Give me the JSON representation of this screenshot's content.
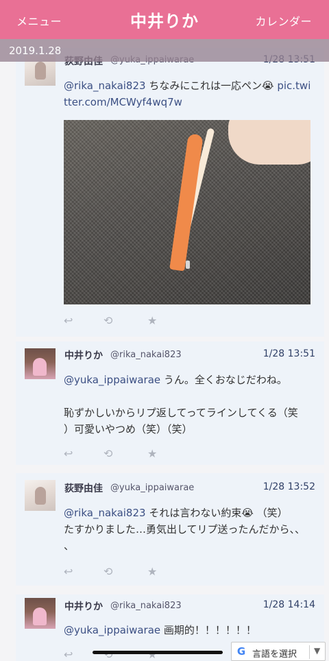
{
  "header": {
    "menu_label": "メニュー",
    "title": "中井りか",
    "calendar_label": "カレンダー",
    "color": "#e97095"
  },
  "date_bar": {
    "date": "2019.1.28"
  },
  "tweets": [
    {
      "name": "荻野由佳",
      "handle": "@yuka_ippaiwarae",
      "time": "1/28 13:51",
      "mention": "@rika_nakai823",
      "text": " ちなみにこれは一応ペン😭",
      "link_part1": "pic.twi",
      "link_part2": "tter.com/MCWyf4wq7w"
    },
    {
      "name": "中井りか",
      "handle": "@rika_nakai823",
      "time": "1/28 13:51",
      "mention": "@yuka_ippaiwarae",
      "text_line1": " うん。全くおなじだわね。",
      "text_line2": "恥ずかしいからリプ返してってラインしてくる（笑",
      "text_line3": "）可愛いやつめ（笑）（笑）"
    },
    {
      "name": "荻野由佳",
      "handle": "@yuka_ippaiwarae",
      "time": "1/28 13:52",
      "mention": "@rika_nakai823",
      "text_line1": " それは言わない約束😭 （笑）",
      "text_line2": "たすかりました…勇気出してリプ送ったんだから、、",
      "text_line3": "、"
    },
    {
      "name": "中井りか",
      "handle": "@rika_nakai823",
      "time": "1/28 14:14",
      "mention": "@yuka_ippaiwarae",
      "text": " 画期的！！！！！！"
    }
  ],
  "actions": {
    "reply_icon": "↩",
    "retweet_icon": "⟲",
    "favorite_icon": "★"
  },
  "translate_widget": {
    "label": "言語を選択",
    "arrow": "▼",
    "logo": "G"
  }
}
